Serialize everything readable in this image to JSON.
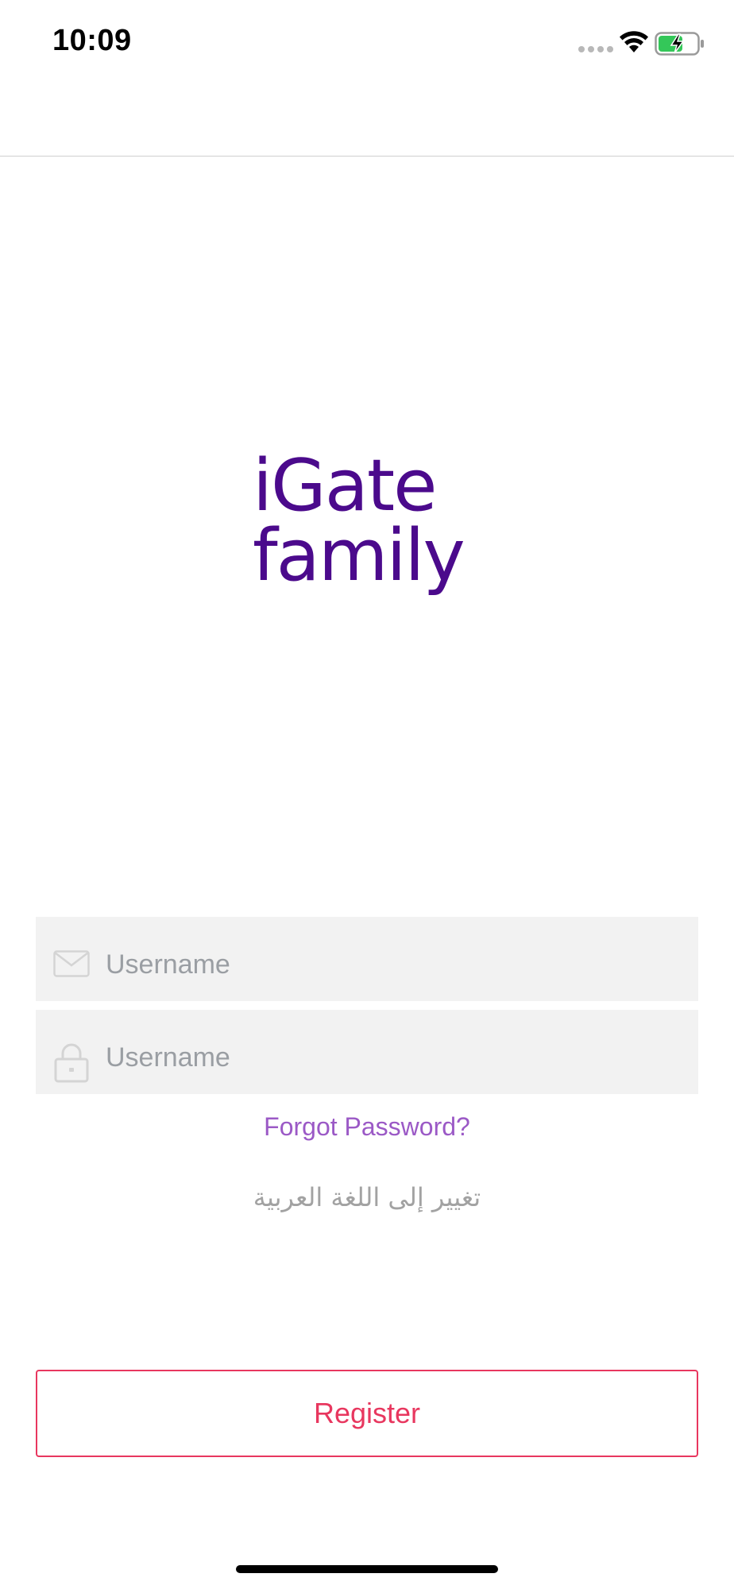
{
  "status_bar": {
    "time": "10:09",
    "icons": [
      "signal-dots-icon",
      "wifi-icon",
      "battery-charging-icon"
    ],
    "battery_color": "#34c759"
  },
  "logo": {
    "line1": "iGate",
    "line2": "family",
    "color": "#4b0a8c"
  },
  "form": {
    "username": {
      "placeholder": "Username",
      "icon": "envelope-icon",
      "value": ""
    },
    "password": {
      "placeholder": "Username",
      "icon": "lock-icon",
      "value": ""
    },
    "forgot_password": "Forgot Password?",
    "change_language": "تغيير إلى اللغة العربية"
  },
  "register_button": {
    "label": "Register",
    "color": "#e8375f"
  },
  "colors": {
    "link": "#9b59c6",
    "muted": "#a2a2a2",
    "input_bg": "#f2f2f2"
  }
}
